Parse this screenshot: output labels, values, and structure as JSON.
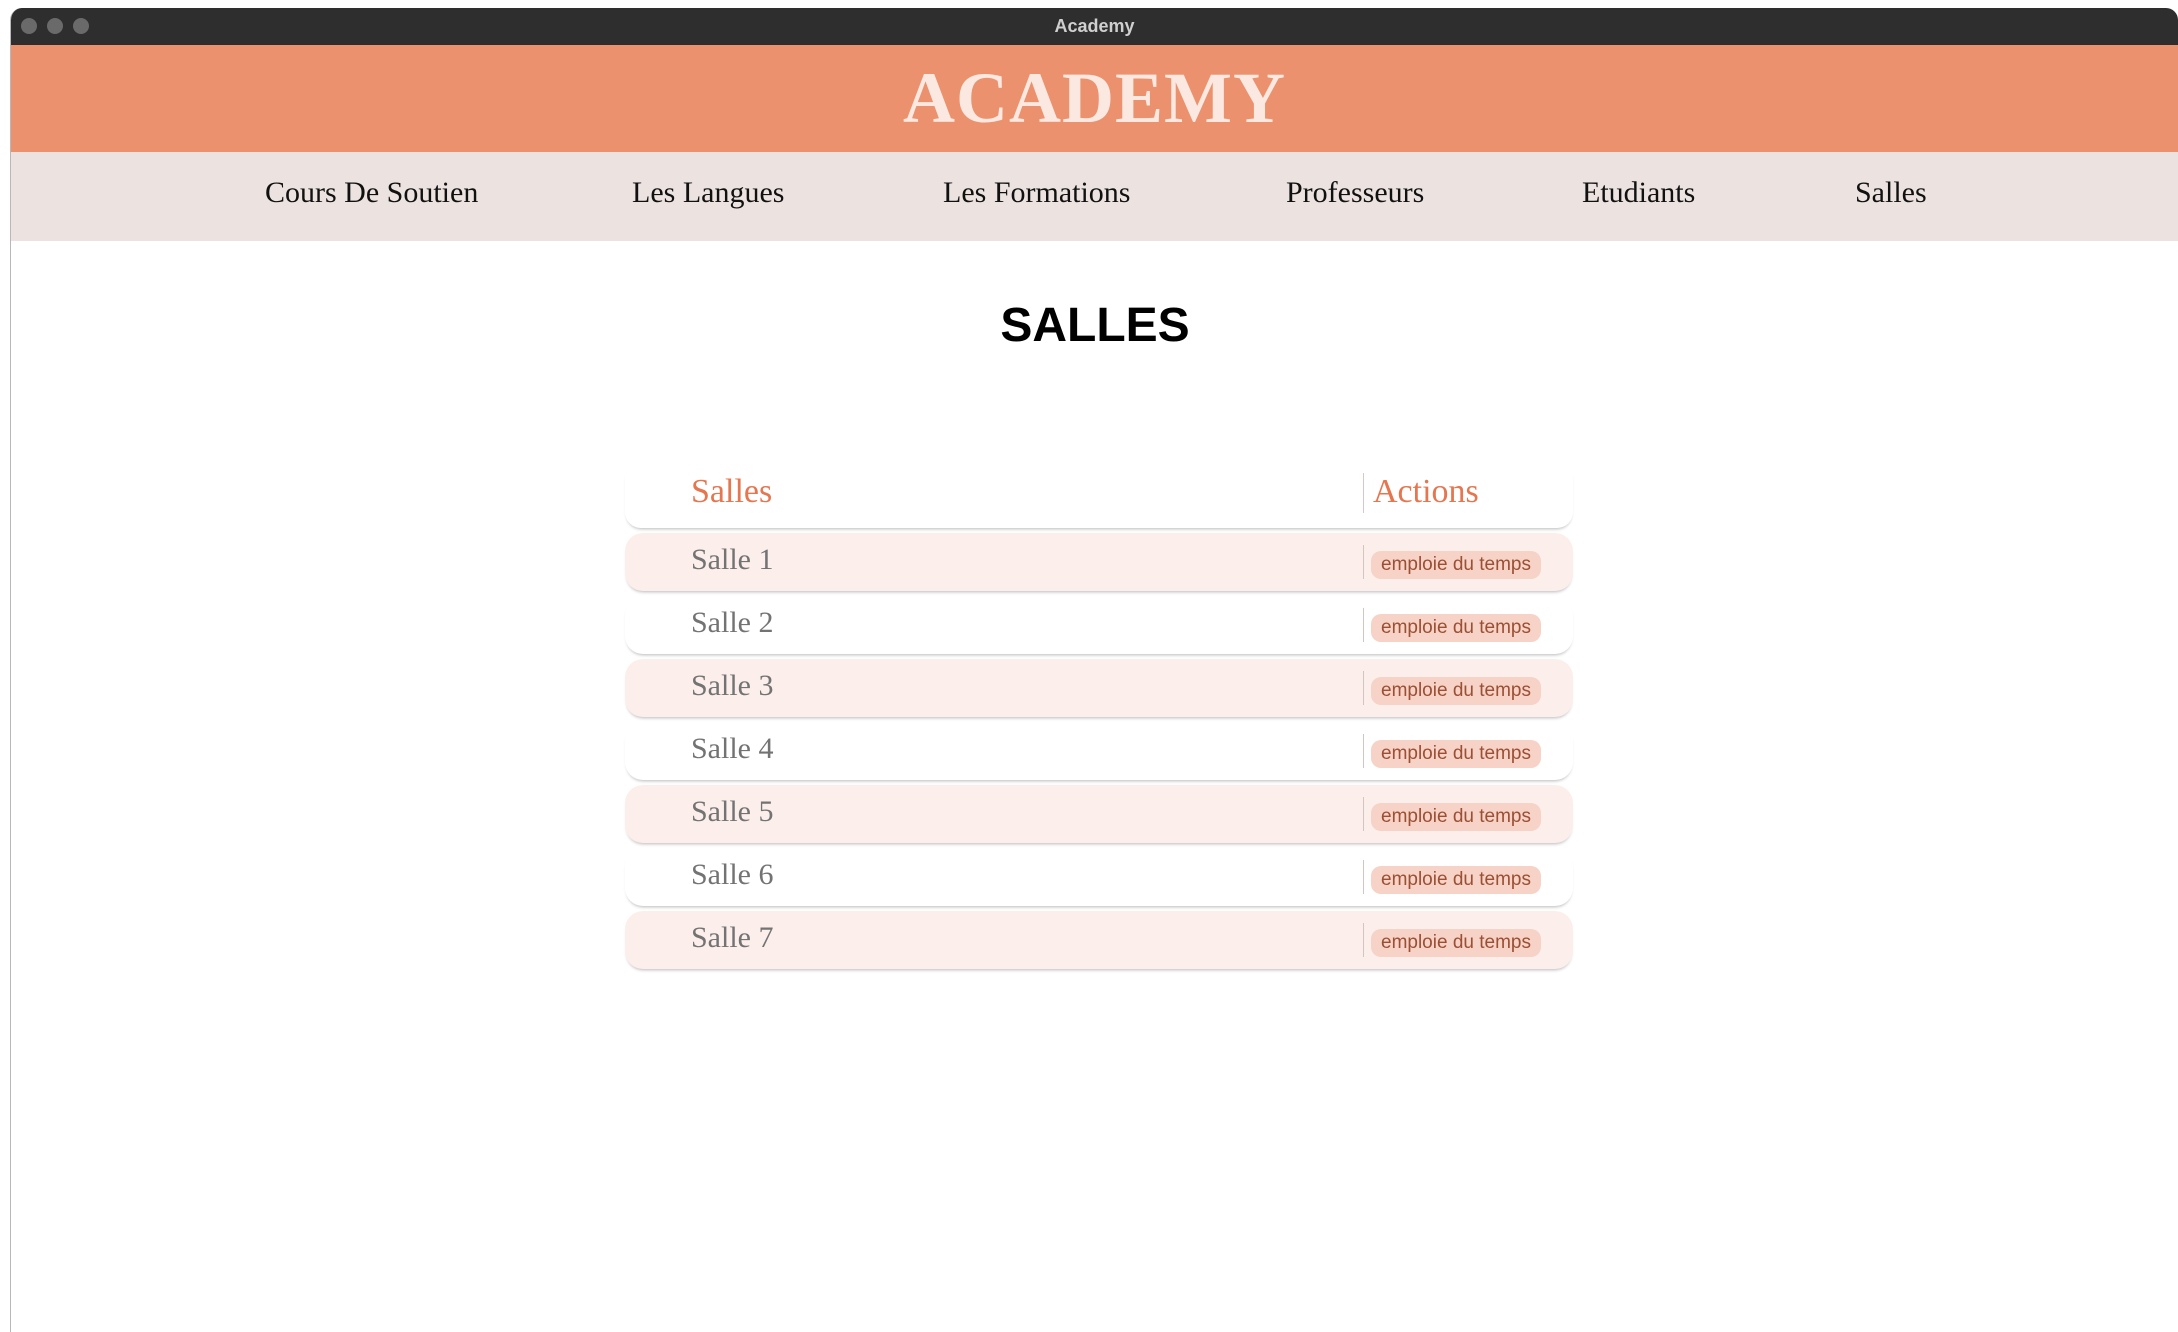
{
  "window": {
    "title": "Academy"
  },
  "brand": {
    "name": "ACADEMY"
  },
  "nav": {
    "items": [
      "Cours De Soutien",
      "Les Langues",
      "Les Formations",
      "Professeurs",
      "Etudiants",
      "Salles"
    ]
  },
  "page": {
    "title": "SALLES"
  },
  "table": {
    "headers": {
      "name": "Salles",
      "actions": "Actions"
    },
    "rows": [
      {
        "name": "Salle 1",
        "action": "emploie du temps"
      },
      {
        "name": "Salle 2",
        "action": "emploie du temps"
      },
      {
        "name": "Salle 3",
        "action": "emploie du temps"
      },
      {
        "name": "Salle 4",
        "action": "emploie du temps"
      },
      {
        "name": "Salle 5",
        "action": "emploie du temps"
      },
      {
        "name": "Salle 6",
        "action": "emploie du temps"
      },
      {
        "name": "Salle 7",
        "action": "emploie du temps"
      }
    ]
  },
  "colors": {
    "brand_bar": "#ec916d",
    "nav_bar": "#ece3e1",
    "accent_text": "#e5764f",
    "row_alt": "#fcefeb",
    "button_bg": "#f6d3c6"
  }
}
